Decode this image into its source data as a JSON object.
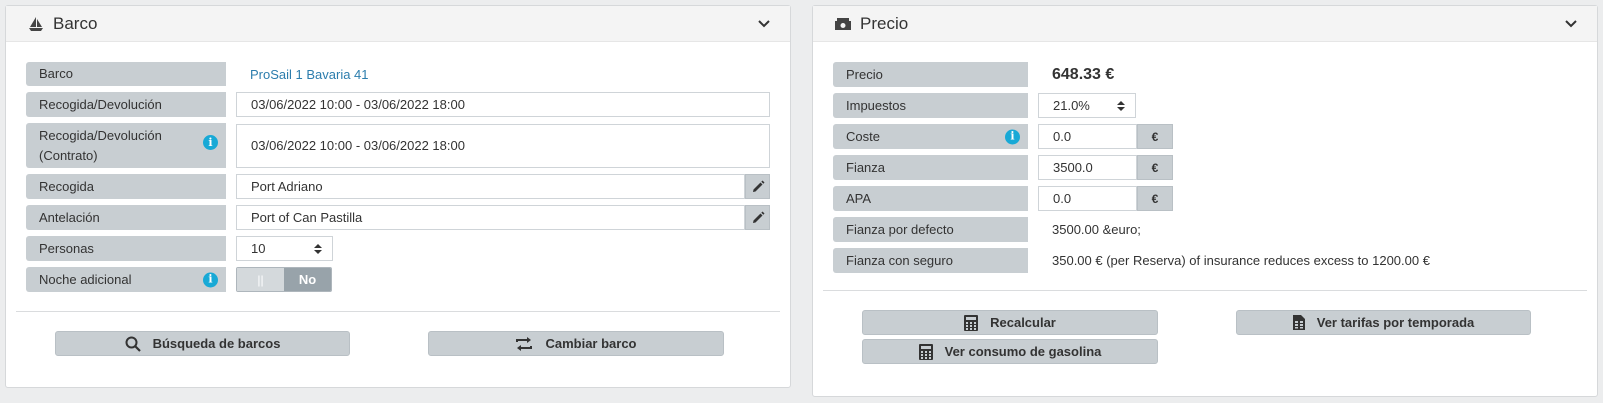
{
  "boat_panel": {
    "title": "Barco",
    "fields": {
      "boat": {
        "label": "Barco",
        "value": "ProSail 1 Bavaria 41"
      },
      "pickup_return": {
        "label": "Recogida/Devolución",
        "value": "03/06/2022 10:00 - 03/06/2022 18:00"
      },
      "pickup_return_contract": {
        "label_line1": "Recogida/Devolución",
        "label_line2": "(Contrato)",
        "value": "03/06/2022 10:00 - 03/06/2022 18:00"
      },
      "pickup": {
        "label": "Recogida",
        "value": "Port Adriano"
      },
      "advance": {
        "label": "Antelación",
        "value": "Port of Can Pastilla"
      },
      "persons": {
        "label": "Personas",
        "value": "10"
      },
      "extra_night": {
        "label": "Noche adicional",
        "off_glyph": "||",
        "on_label": "No"
      }
    },
    "buttons": {
      "search": "Búsqueda de barcos",
      "change": "Cambiar barco"
    }
  },
  "price_panel": {
    "title": "Precio",
    "fields": {
      "price": {
        "label": "Precio",
        "value": "648.33 €"
      },
      "taxes": {
        "label": "Impuestos",
        "value": "21.0%"
      },
      "cost": {
        "label": "Coste",
        "value": "0.0",
        "currency": "€"
      },
      "deposit": {
        "label": "Fianza",
        "value": "3500.0",
        "currency": "€"
      },
      "apa": {
        "label": "APA",
        "value": "0.0",
        "currency": "€"
      },
      "default_deposit": {
        "label": "Fianza por defecto",
        "value": "3500.00 &euro;"
      },
      "insured_deposit": {
        "label": "Fianza con seguro",
        "value": "350.00 € (per Reserva) of insurance reduces excess to 1200.00 €"
      }
    },
    "buttons": {
      "recalc": "Recalcular",
      "season_rates": "Ver tarifas por temporada",
      "fuel": "Ver consumo de gasolina"
    }
  },
  "colors": {
    "label_bg": "#c8ced2",
    "info": "#18a9d6",
    "link": "#2c7dad",
    "toggle_on": "#98a3aa"
  }
}
